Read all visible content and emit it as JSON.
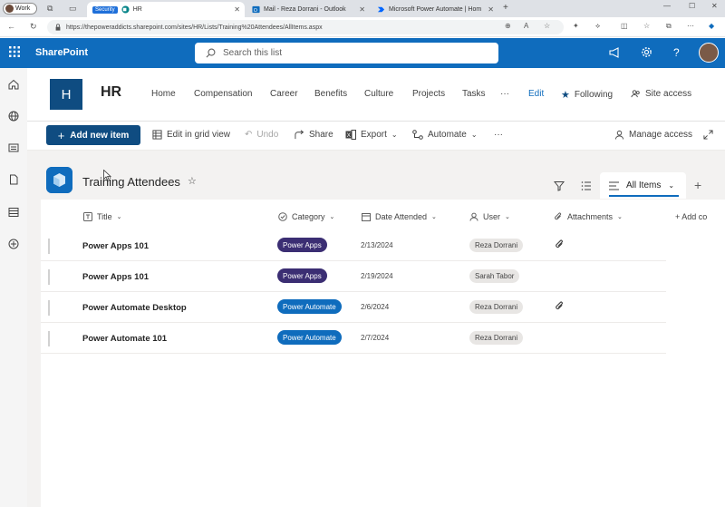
{
  "browser": {
    "profile_label": "Work",
    "tabs": [
      {
        "label": "HR",
        "badge": "Security",
        "active": true
      },
      {
        "label": "Mail - Reza Dorrani - Outlook",
        "active": false
      },
      {
        "label": "Microsoft Power Automate | Hom",
        "active": false
      }
    ],
    "url": "https://thepoweraddicts.sharepoint.com/sites/HR/Lists/Training%20Attendees/AllItems.aspx"
  },
  "suite": {
    "app_name": "SharePoint",
    "search_placeholder": "Search this list",
    "help_label": "?"
  },
  "site": {
    "logo_letter": "H",
    "name": "HR",
    "nav": [
      "Home",
      "Compensation",
      "Career",
      "Benefits",
      "Culture",
      "Projects",
      "Tasks",
      "···",
      "Edit"
    ],
    "following_label": "Following",
    "site_access_label": "Site access"
  },
  "command_bar": {
    "add_new": "Add new item",
    "edit_grid": "Edit in grid view",
    "undo": "Undo",
    "share": "Share",
    "export": "Export",
    "automate": "Automate",
    "more": "···",
    "manage_access": "Manage access"
  },
  "list": {
    "title": "Training Attendees",
    "view_name": "All Items",
    "columns": [
      "Title",
      "Category",
      "Date Attended",
      "User",
      "Attachments",
      "+ Add co"
    ],
    "rows": [
      {
        "title": "Power Apps 101",
        "category": "Power Apps",
        "date": "2/13/2024",
        "user": "Reza Dorrani",
        "attachment": true
      },
      {
        "title": "Power Apps 101",
        "category": "Power Apps",
        "date": "2/19/2024",
        "user": "Sarah Tabor",
        "attachment": false
      },
      {
        "title": "Power Automate Desktop",
        "category": "Power Automate",
        "date": "2/6/2024",
        "user": "Reza Dorrani",
        "attachment": true
      },
      {
        "title": "Power Automate 101",
        "category": "Power Automate",
        "date": "2/7/2024",
        "user": "Reza Dorrani",
        "attachment": false
      }
    ]
  },
  "colors": {
    "suite_blue": "#0f6cbd",
    "site_blue": "#0f4c81",
    "power_apps_pill": "#3b2e73",
    "power_automate_pill": "#0f6cbd"
  }
}
